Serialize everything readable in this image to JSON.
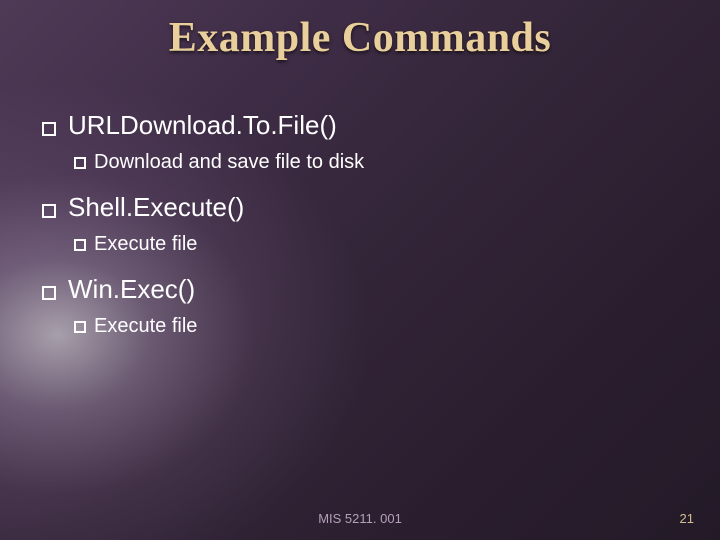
{
  "title": "Example Commands",
  "items": [
    {
      "label": "URLDownload.To.File()",
      "sub": "Download and save file to disk"
    },
    {
      "label": "Shell.Execute()",
      "sub": "Execute file"
    },
    {
      "label": "Win.Exec()",
      "sub": "Execute file"
    }
  ],
  "footer": {
    "course": "MIS 5211. 001",
    "page": "21"
  }
}
